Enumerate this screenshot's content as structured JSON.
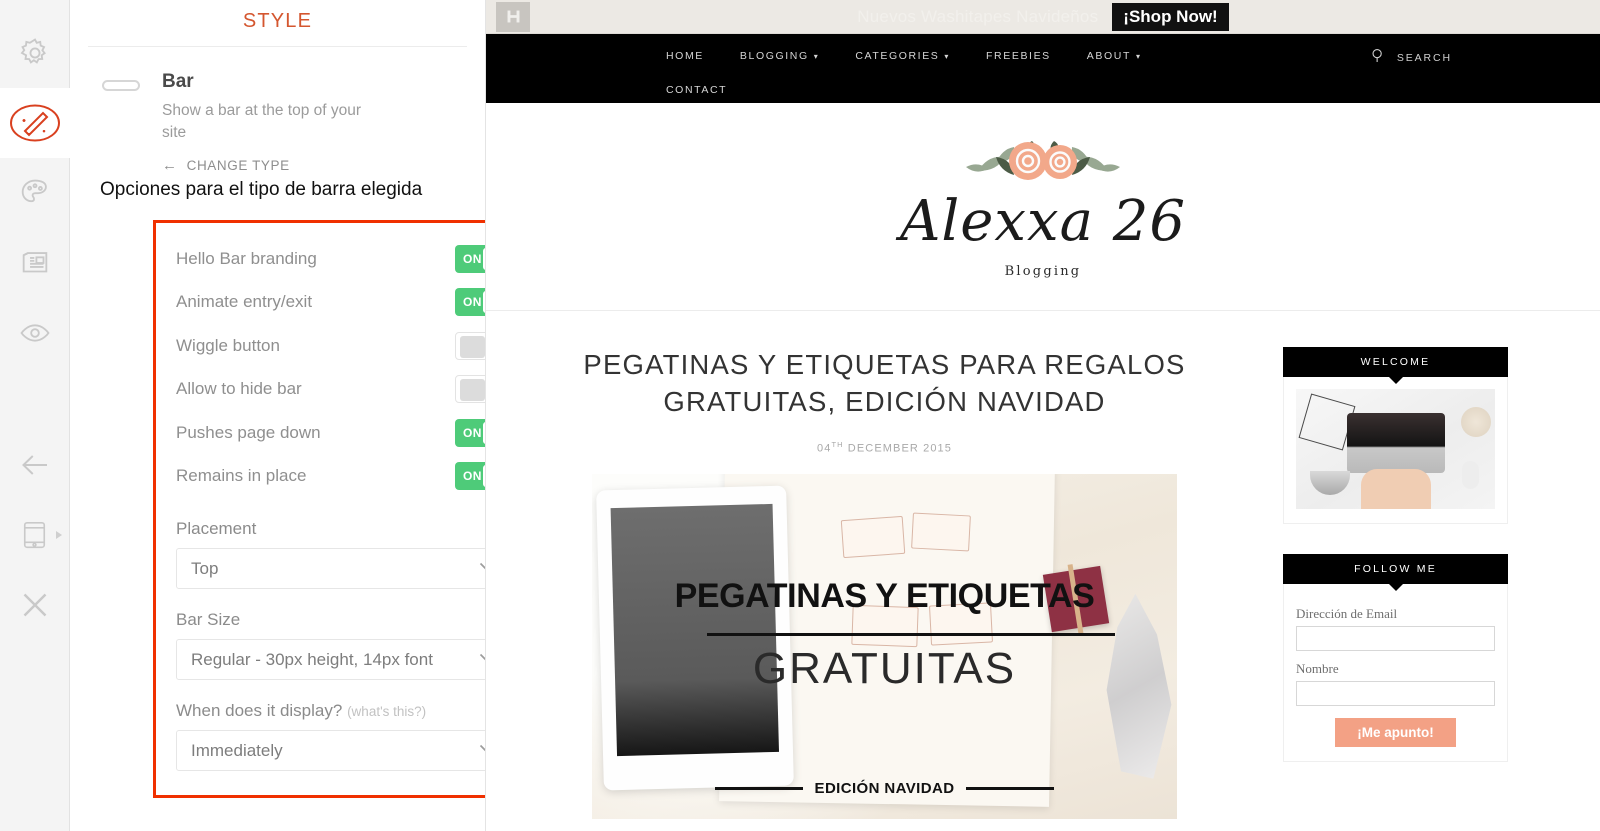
{
  "rail": {
    "items": [
      {
        "name": "settings",
        "icon": "gear-icon",
        "active": false
      },
      {
        "name": "style",
        "icon": "magic-wand-icon",
        "active": true
      },
      {
        "name": "colors",
        "icon": "palette-icon",
        "active": false
      },
      {
        "name": "content",
        "icon": "article-icon",
        "active": false
      },
      {
        "name": "preview",
        "icon": "eye-icon",
        "active": false
      },
      {
        "name": "back",
        "icon": "arrow-left-icon",
        "active": false
      },
      {
        "name": "device-preview",
        "icon": "mobile-device-icon",
        "active": false
      },
      {
        "name": "close",
        "icon": "close-x-icon",
        "active": false
      }
    ]
  },
  "panel": {
    "title": "STYLE",
    "type": {
      "icon": "bar-shape-icon",
      "name": "Bar",
      "description": "Show a bar at the top of your site",
      "change_type_label": "CHANGE TYPE",
      "back_arrow": "←"
    },
    "annotation_caption": "Opciones para el tipo de barra elegida",
    "annotation_color": "#f03000",
    "toggles": [
      {
        "label": "Hello Bar branding",
        "state": "ON",
        "on": true
      },
      {
        "label": "Animate entry/exit",
        "state": "ON",
        "on": true
      },
      {
        "label": "Wiggle button",
        "state": "OFF",
        "on": false
      },
      {
        "label": "Allow to hide bar",
        "state": "OFF",
        "on": false
      },
      {
        "label": "Pushes page down",
        "state": "ON",
        "on": true
      },
      {
        "label": "Remains in place",
        "state": "ON",
        "on": true
      }
    ],
    "fields": [
      {
        "label": "Placement",
        "hint": "",
        "value": "Top"
      },
      {
        "label": "Bar Size",
        "hint": "",
        "value": "Regular - 30px height, 14px font"
      },
      {
        "label": "When does it display?",
        "hint": "(what's this?)",
        "value": "Immediately"
      }
    ],
    "toggle_on_color": "#4ecb79",
    "accent_color": "#d4562f"
  },
  "preview": {
    "hellobar": {
      "logo": "hello-bar-h-icon",
      "message": "Nuevos Washitapes Navideños",
      "cta": "¡Shop Now!",
      "background": "#ece9e4"
    },
    "nav": {
      "items": [
        {
          "label": "HOME",
          "caret": false
        },
        {
          "label": "BLOGGING",
          "caret": true
        },
        {
          "label": "CATEGORIES",
          "caret": true
        },
        {
          "label": "FREEBIES",
          "caret": false
        },
        {
          "label": "ABOUT",
          "caret": true
        }
      ],
      "second_row": [
        {
          "label": "CONTACT",
          "caret": false
        }
      ],
      "search_label": "SEARCH",
      "caret_glyph": "▾"
    },
    "site": {
      "logo_text": "Alexxa 26",
      "logo_subtitle": "Blogging"
    },
    "post": {
      "title": "PEGATINAS Y ETIQUETAS PARA REGALOS GRATUITAS, EDICIÓN NAVIDAD",
      "date_day": "04",
      "date_sup": "TH",
      "date_rest": " DECEMBER 2015",
      "featured_overlay_title": "PEGATINAS Y ETIQUETAS",
      "featured_overlay_sub": "GRATUITAS",
      "featured_overlay_bottom": "EDICIÓN NAVIDAD"
    },
    "sidebar": {
      "welcome": {
        "title": "WELCOME",
        "photo": "desk-laptop-photo"
      },
      "follow": {
        "title": "FOLLOW ME",
        "email_label": "Dirección de Email",
        "email_value": "",
        "name_label": "Nombre",
        "name_value": "",
        "submit_label": "¡Me apunto!",
        "submit_color": "#f3a185"
      }
    }
  }
}
